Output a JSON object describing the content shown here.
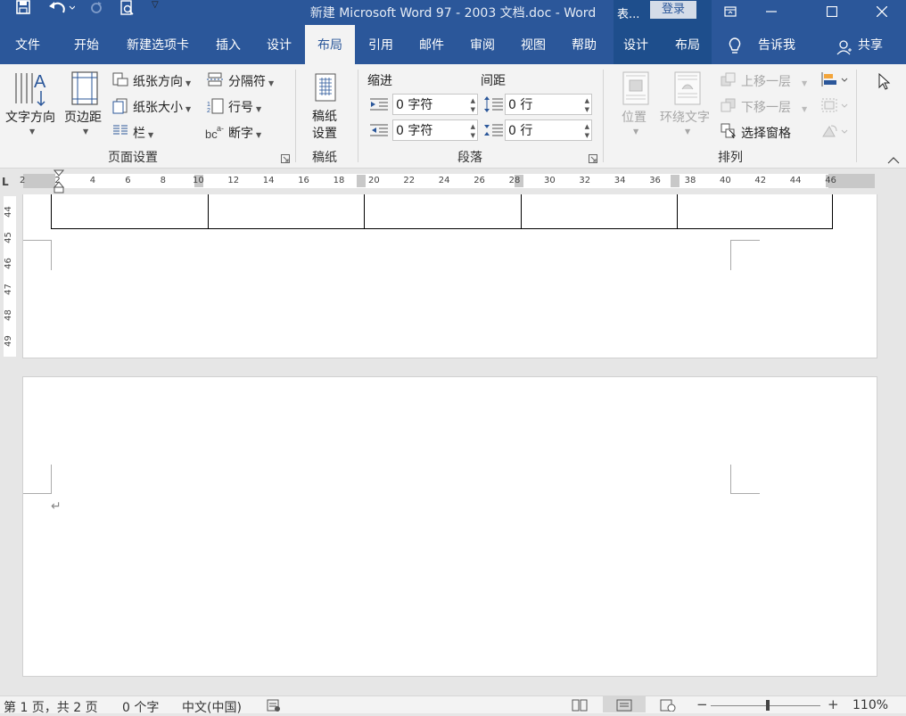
{
  "titlebar": {
    "doc_title": "新建 Microsoft Word 97 - 2003 文档.doc  -  Word",
    "context_label": "表...",
    "login": "登录",
    "save_icon": "save-icon",
    "undo_icon": "undo-icon",
    "redo_icon": "redo-icon",
    "preview_icon": "print-preview-icon",
    "customize_icon": "chevron-down-icon"
  },
  "tabs": [
    "文件",
    "开始",
    "新建选项卡",
    "插入",
    "设计",
    "布局",
    "引用",
    "邮件",
    "审阅",
    "视图",
    "帮助",
    "设计",
    "布局"
  ],
  "active_tab_index": 5,
  "tell_me": "告诉我",
  "share": "共享",
  "ribbon": {
    "page_setup": {
      "text_direction": "文字方向",
      "margins": "页边距",
      "orientation": "纸张方向",
      "size": "纸张大小",
      "columns": "栏",
      "breaks": "分隔符",
      "line_numbers": "行号",
      "hyphenation": "断字",
      "group_label": "页面设置"
    },
    "manuscript": {
      "settings": "稿纸设置",
      "settings_line1": "稿纸",
      "settings_line2": "设置",
      "group_label": "稿纸"
    },
    "paragraph": {
      "indent_label": "缩进",
      "spacing_label": "间距",
      "indent_left": "0 字符",
      "indent_right": "0 字符",
      "spacing_before": "0 行",
      "spacing_after": "0 行",
      "group_label": "段落"
    },
    "arrange": {
      "position": "位置",
      "wrap_text": "环绕文字",
      "bring_forward": "上移一层",
      "send_backward": "下移一层",
      "selection_pane": "选择窗格",
      "group_label": "排列"
    }
  },
  "ruler": {
    "h_numbers": [
      "2",
      "2",
      "4",
      "6",
      "8",
      "10",
      "12",
      "14",
      "16",
      "18",
      "20",
      "22",
      "24",
      "26",
      "28",
      "30",
      "32",
      "34",
      "36",
      "38",
      "40",
      "42",
      "44",
      "46"
    ],
    "v_numbers": [
      "44",
      "45",
      "46",
      "47",
      "48",
      "49"
    ],
    "corner": "L"
  },
  "statusbar": {
    "page_info": "第 1 页，共 2 页",
    "word_count": "0 个字",
    "language": "中文(中国)",
    "zoom": "110%",
    "zoom_minus": "−",
    "zoom_plus": "+"
  },
  "colors": {
    "brand": "#2b579a",
    "context_tab": "#1e4e8c",
    "ribbon_bg": "#f3f3f3"
  }
}
